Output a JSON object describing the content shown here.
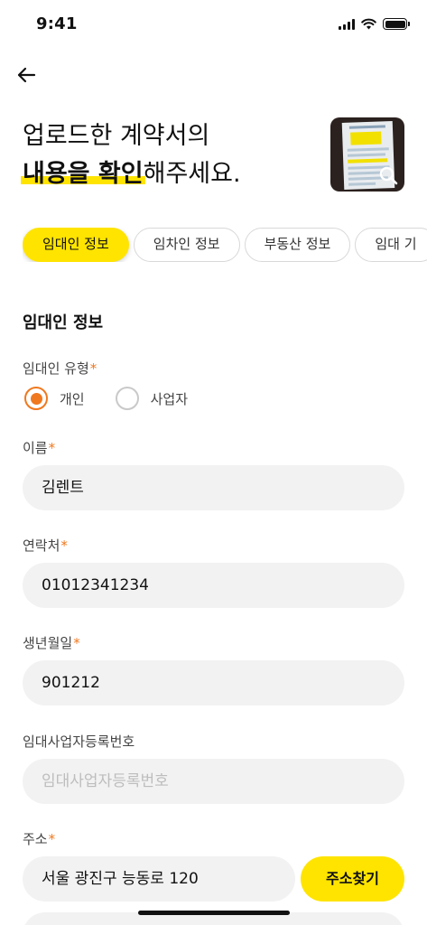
{
  "status_bar": {
    "time": "9:41"
  },
  "heading": {
    "line1": "업로드한 계약서의",
    "highlight": "내용을 확인",
    "rest": "해주세요."
  },
  "tabs": [
    {
      "label": "임대인 정보",
      "active": true
    },
    {
      "label": "임차인 정보",
      "active": false
    },
    {
      "label": "부동산 정보",
      "active": false
    },
    {
      "label": "임대 기",
      "active": false
    }
  ],
  "section": {
    "title": "임대인 정보"
  },
  "landlord_type": {
    "label": "임대인 유형",
    "required_mark": "*",
    "options": [
      {
        "label": "개인",
        "checked": true
      },
      {
        "label": "사업자",
        "checked": false
      }
    ]
  },
  "fields": {
    "name": {
      "label": "이름",
      "required_mark": "*",
      "value": "김렌트"
    },
    "phone": {
      "label": "연락처",
      "required_mark": "*",
      "value": "01012341234"
    },
    "birth": {
      "label": "생년월일",
      "required_mark": "*",
      "value": "901212"
    },
    "biz_no": {
      "label": "임대사업자등록번호",
      "placeholder": "임대사업자등록번호"
    },
    "address": {
      "label": "주소",
      "required_mark": "*",
      "value": "서울 광진구 능동로 120"
    }
  },
  "buttons": {
    "search_address": "주소찾기"
  },
  "colors": {
    "accent_yellow": "#ffe400",
    "accent_orange": "#f0781e",
    "field_bg": "#f2f2f2"
  },
  "icons": {
    "back": "arrow-left-icon",
    "search": "search-icon",
    "wifi": "wifi-icon",
    "signal": "cellular-signal-icon",
    "battery": "battery-icon"
  }
}
